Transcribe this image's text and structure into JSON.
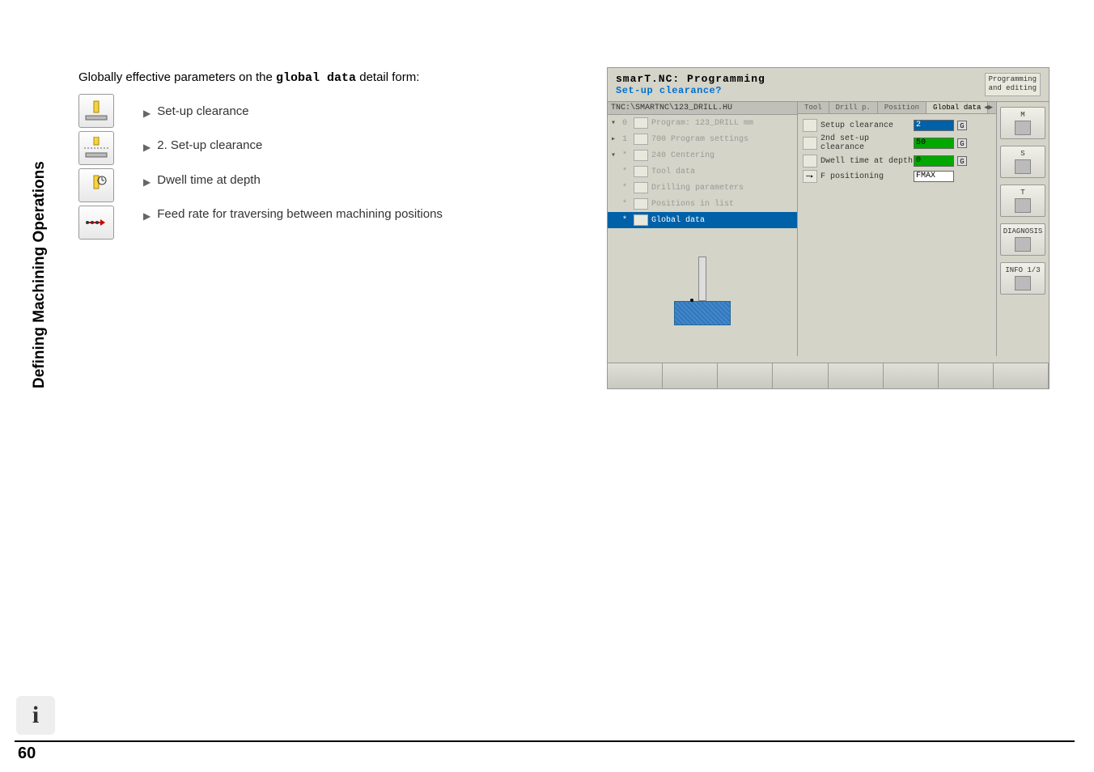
{
  "sidebar_title": "Defining Machining Operations",
  "intro": {
    "prefix": "Globally effective parameters on the ",
    "mono": "global data",
    "suffix": " detail form:"
  },
  "bullets": [
    "Set-up clearance",
    "2. Set-up clearance",
    "Dwell time at depth",
    "Feed rate for traversing between machining positions"
  ],
  "icon_column": [
    "clearance-icon-1",
    "clearance-icon-2",
    "dwell-icon",
    "feed-positioning-icon"
  ],
  "screenshot": {
    "title": "smarT.NC: Programming",
    "subtitle": "Set-up clearance?",
    "mode_label": "Programming\nand editing",
    "tree_path": "TNC:\\SMARTNC\\123_DRILL.HU",
    "tree": [
      {
        "exp": "▾",
        "num": "0",
        "label": "Program: 123_DRILL mm",
        "faded": true
      },
      {
        "exp": "▸",
        "num": "1",
        "label": "700 Program settings",
        "faded": true
      },
      {
        "exp": "▾",
        "num": "*",
        "label": "240 Centering",
        "faded": true
      },
      {
        "exp": "",
        "num": "*",
        "label": "Tool data",
        "faded": true
      },
      {
        "exp": "",
        "num": "*",
        "label": "Drilling parameters",
        "faded": true
      },
      {
        "exp": "",
        "num": "*",
        "label": "Positions in list",
        "faded": true
      },
      {
        "exp": "",
        "num": "*",
        "label": "Global data",
        "faded": false,
        "selected": true
      }
    ],
    "tabs": [
      "Tool",
      "Drill p.",
      "Position",
      "Global data"
    ],
    "active_tab": 3,
    "form_rows": [
      {
        "label": "Setup clearance",
        "value": "2",
        "unit": "G",
        "style": "focused"
      },
      {
        "label": "2nd set-up clearance",
        "value": "50",
        "unit": "G",
        "style": "green"
      },
      {
        "label": "Dwell time at depth",
        "value": "0",
        "unit": "G",
        "style": "green"
      },
      {
        "label": "F positioning",
        "value": "FMAX",
        "unit": "",
        "style": "plain",
        "icon_text": "⋯▸"
      }
    ],
    "right_toolbar": [
      {
        "letter": "M"
      },
      {
        "letter": "S"
      },
      {
        "letter": "T"
      },
      {
        "label": "DIAGNOSIS"
      },
      {
        "label": "INFO 1/3"
      }
    ]
  },
  "page_number": "60"
}
